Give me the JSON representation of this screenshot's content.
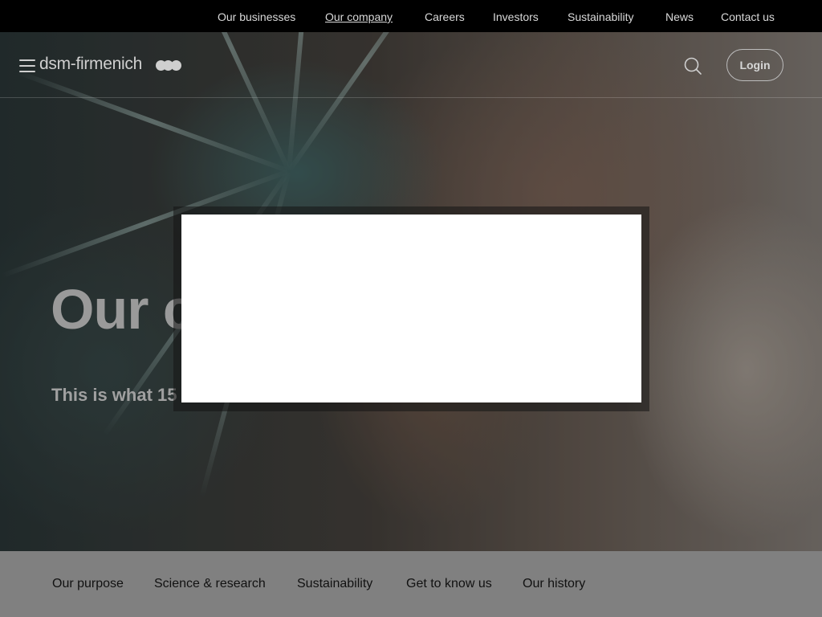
{
  "topnav": {
    "items": [
      {
        "label": "Our businesses",
        "active": false
      },
      {
        "label": "Our company",
        "active": true
      },
      {
        "label": "Careers",
        "active": false
      },
      {
        "label": "Investors",
        "active": false
      },
      {
        "label": "Sustainability",
        "active": false
      },
      {
        "label": "News",
        "active": false
      },
      {
        "label": "Contact us",
        "active": false
      }
    ]
  },
  "header": {
    "logo_text": "dsm-firmenich",
    "menu_icon": "hamburger-icon",
    "search_icon": "search-icon",
    "login_label": "Login"
  },
  "hero": {
    "title_visible": "Our c",
    "subtitle_visible": "This is what 15"
  },
  "subnav": {
    "items": [
      {
        "label": "Our purpose"
      },
      {
        "label": "Science & research"
      },
      {
        "label": "Sustainability"
      },
      {
        "label": "Get to know us"
      },
      {
        "label": "Our history"
      }
    ]
  },
  "colors": {
    "topbar_bg": "#000000",
    "subnav_bg": "#808080",
    "modal_bg": "#ffffff",
    "text_light": "#d9d9d9"
  }
}
